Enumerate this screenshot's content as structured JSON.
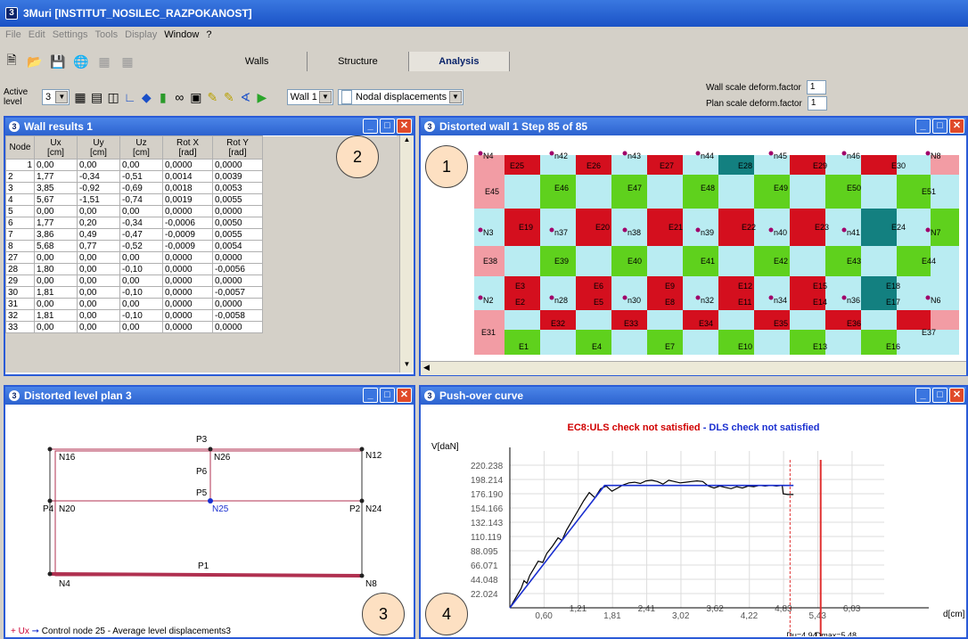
{
  "app": {
    "title": "3Muri  [INSTITUT_NOSILEC_RAZPOKANOST]",
    "icon": "3"
  },
  "menu": [
    "File",
    "Edit",
    "Settings",
    "Tools",
    "Display",
    "Window",
    "?"
  ],
  "tabs": [
    "Walls",
    "Structure",
    "Analysis"
  ],
  "active_level": {
    "label": "Active level",
    "value": "3"
  },
  "wall_select": "Wall 1",
  "view_select": "Nodal displacements",
  "scale": {
    "wall_label": "Wall scale deform.factor",
    "wall_value": "1",
    "plan_label": "Plan scale deform.factor",
    "plan_value": "1"
  },
  "wall_results": {
    "title": "Wall results 1",
    "headers": [
      [
        "Node",
        ""
      ],
      [
        "Ux",
        "[cm]"
      ],
      [
        "Uy",
        "[cm]"
      ],
      [
        "Uz",
        "[cm]"
      ],
      [
        "Rot X",
        "[rad]"
      ],
      [
        "Rot Y",
        "[rad]"
      ]
    ],
    "rows": [
      [
        "1",
        "0,00",
        "0,00",
        "0,00",
        "0,0000",
        "0,0000"
      ],
      [
        "2",
        "1,77",
        "-0,34",
        "-0,51",
        "0,0014",
        "0,0039"
      ],
      [
        "3",
        "3,85",
        "-0,92",
        "-0,69",
        "0,0018",
        "0,0053"
      ],
      [
        "4",
        "5,67",
        "-1,51",
        "-0,74",
        "0,0019",
        "0,0055"
      ],
      [
        "5",
        "0,00",
        "0,00",
        "0,00",
        "0,0000",
        "0,0000"
      ],
      [
        "6",
        "1,77",
        "0,20",
        "-0,34",
        "-0,0006",
        "0,0050"
      ],
      [
        "7",
        "3,86",
        "0,49",
        "-0,47",
        "-0,0009",
        "0,0055"
      ],
      [
        "8",
        "5,68",
        "0,77",
        "-0,52",
        "-0,0009",
        "0,0054"
      ],
      [
        "27",
        "0,00",
        "0,00",
        "0,00",
        "0,0000",
        "0,0000"
      ],
      [
        "28",
        "1,80",
        "0,00",
        "-0,10",
        "0,0000",
        "-0,0056"
      ],
      [
        "29",
        "0,00",
        "0,00",
        "0,00",
        "0,0000",
        "0,0000"
      ],
      [
        "30",
        "1,81",
        "0,00",
        "-0,10",
        "0,0000",
        "-0,0057"
      ],
      [
        "31",
        "0,00",
        "0,00",
        "0,00",
        "0,0000",
        "0,0000"
      ],
      [
        "32",
        "1,81",
        "0,00",
        "-0,10",
        "0,0000",
        "-0,0058"
      ],
      [
        "33",
        "0,00",
        "0,00",
        "0,00",
        "0,0000",
        "0,0000"
      ]
    ]
  },
  "distorted_wall": {
    "title": "Distorted wall 1 Step 85 of 85",
    "nodes": [
      "N4",
      "n42",
      "n43",
      "n44",
      "n45",
      "n46",
      "N8",
      "N3",
      "n37",
      "n38",
      "n39",
      "n40",
      "n41",
      "N7",
      "N2",
      "n28",
      "n30",
      "n32",
      "n34",
      "n36",
      "N6",
      "N1",
      "n27",
      "n29",
      "n31",
      "n33",
      "n35",
      "N5"
    ],
    "elements": [
      "E25",
      "E26",
      "E27",
      "E28",
      "E29",
      "E30",
      "E45",
      "E46",
      "E47",
      "E48",
      "E49",
      "E50",
      "E51",
      "E19",
      "E20",
      "E21",
      "E22",
      "E23",
      "E24",
      "E38",
      "E39",
      "E40",
      "E41",
      "E42",
      "E43",
      "E44",
      "E3",
      "E6",
      "E9",
      "E12",
      "E15",
      "E18",
      "E2",
      "E5",
      "E8",
      "E11",
      "E14",
      "E17",
      "E31",
      "E32",
      "E33",
      "E34",
      "E35",
      "E36",
      "E37",
      "E1",
      "E4",
      "E7",
      "E10",
      "E13",
      "E16"
    ]
  },
  "level_plan": {
    "title": "Distorted level plan 3",
    "labels": [
      "P3",
      "N16",
      "N26",
      "N12",
      "P6",
      "P5",
      "N20",
      "N25",
      "P4",
      "P2",
      "N24",
      "P1",
      "N4",
      "N8"
    ],
    "footer_ux": "+ Ux",
    "footer_text": "Control node 25  -  Average level displacements3"
  },
  "pushover": {
    "title": "Push-over curve",
    "status_ec8": "EC8:",
    "status_uls": "ULS check not satisfied",
    "status_sep": " - ",
    "status_dls": "DLS check not satisfied",
    "du_label": "Du=4,94",
    "dmax_label": "Dmax=5,48"
  },
  "chart_data": {
    "type": "line",
    "title": "",
    "xlabel": "d[cm]",
    "ylabel": "V[daN]",
    "yticks": [
      "220.238",
      "198.214",
      "176.190",
      "154.166",
      "132.143",
      "110.119",
      "88.095",
      "66.071",
      "44.048",
      "22.024"
    ],
    "xticks": [
      "0,60",
      "1,21",
      "1,81",
      "2,41",
      "3,02",
      "3,62",
      "4,22",
      "4,83",
      "5,43",
      "6,03"
    ],
    "xlim": [
      0,
      6.6
    ],
    "ylim": [
      0,
      242260
    ],
    "series": [
      {
        "color": "#000000",
        "x": [
          0,
          0.1,
          0.2,
          0.25,
          0.3,
          0.35,
          0.42,
          0.5,
          0.58,
          0.65,
          0.75,
          0.85,
          0.92,
          1.0,
          1.1,
          1.2,
          1.3,
          1.4,
          1.5,
          1.6,
          1.7,
          1.8,
          1.9,
          2.0,
          2.1,
          2.2,
          2.3,
          2.4,
          2.5,
          2.6,
          2.7,
          2.8,
          2.9,
          3.0,
          3.1,
          3.2,
          3.3,
          3.4,
          3.5,
          3.6,
          3.7,
          3.8,
          3.9,
          4.0,
          4.1,
          4.2,
          4.3,
          4.4,
          4.5,
          4.6,
          4.7,
          4.8,
          4.82,
          4.9,
          5.0
        ],
        "values": [
          0,
          15000,
          30000,
          42000,
          38000,
          50000,
          60000,
          72000,
          70000,
          84000,
          95000,
          108000,
          104000,
          120000,
          135000,
          150000,
          165000,
          178000,
          170000,
          184000,
          188000,
          180000,
          185000,
          190000,
          193000,
          194000,
          192000,
          196000,
          197000,
          195000,
          191000,
          197000,
          195000,
          193000,
          194000,
          195000,
          196000,
          195000,
          188000,
          185000,
          188000,
          186000,
          184000,
          187000,
          185000,
          188000,
          187000,
          189000,
          188000,
          189000,
          188000,
          189000,
          176000,
          175000,
          175000
        ]
      },
      {
        "color": "#1a2fd0",
        "x": [
          0,
          1.67,
          5.0
        ],
        "values": [
          0,
          189000,
          189000
        ]
      }
    ],
    "du": 4.94,
    "dmax": 5.48
  },
  "badges": [
    "1",
    "2",
    "3",
    "4"
  ]
}
